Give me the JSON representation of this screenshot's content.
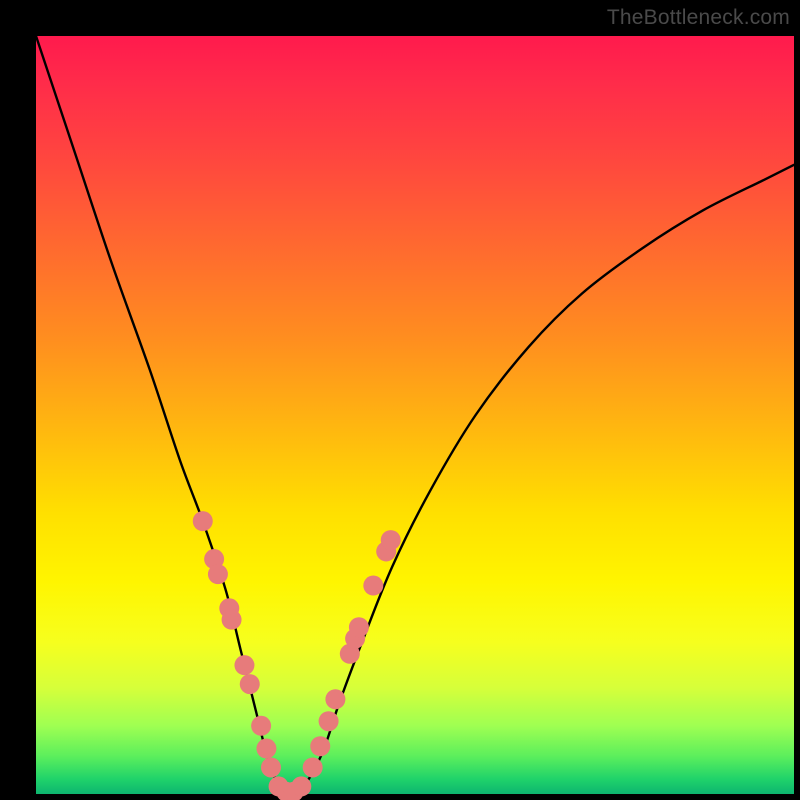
{
  "watermark": "TheBottleneck.com",
  "colors": {
    "frame": "#000000",
    "marker": "#e77b7b",
    "curve": "#000000",
    "gradient_top": "#ff1a4d",
    "gradient_bottom": "#0db56f"
  },
  "chart_data": {
    "type": "line",
    "title": "",
    "xlabel": "",
    "ylabel": "",
    "xlim": [
      0,
      100
    ],
    "ylim": [
      0,
      100
    ],
    "note": "Axes are unlabeled; x and y expressed as 0–100 percent of plot area. y=0 is bottom, y=100 is top.",
    "series": [
      {
        "name": "bottleneck-curve",
        "x": [
          0,
          5,
          10,
          15,
          19,
          22,
          25,
          27,
          29,
          30.5,
          32,
          33,
          34,
          36,
          38,
          40,
          43,
          47,
          52,
          58,
          65,
          72,
          80,
          88,
          96,
          100
        ],
        "y": [
          100,
          85,
          70,
          56,
          44,
          36,
          27,
          19,
          11,
          5,
          1,
          0,
          0,
          2,
          6,
          12,
          20,
          30,
          40,
          50,
          59,
          66,
          72,
          77,
          81,
          83
        ]
      }
    ],
    "markers": {
      "name": "highlighted-points",
      "note": "Salmon dots clustered on the lower V of the curve, both arms.",
      "points": [
        {
          "x": 22.0,
          "y": 36.0
        },
        {
          "x": 23.5,
          "y": 31.0
        },
        {
          "x": 24.0,
          "y": 29.0
        },
        {
          "x": 25.5,
          "y": 24.5
        },
        {
          "x": 25.8,
          "y": 23.0
        },
        {
          "x": 27.5,
          "y": 17.0
        },
        {
          "x": 28.2,
          "y": 14.5
        },
        {
          "x": 29.7,
          "y": 9.0
        },
        {
          "x": 30.4,
          "y": 6.0
        },
        {
          "x": 31.0,
          "y": 3.5
        },
        {
          "x": 32.0,
          "y": 1.0
        },
        {
          "x": 33.0,
          "y": 0.3
        },
        {
          "x": 34.0,
          "y": 0.3
        },
        {
          "x": 35.0,
          "y": 1.0
        },
        {
          "x": 36.5,
          "y": 3.5
        },
        {
          "x": 37.5,
          "y": 6.3
        },
        {
          "x": 38.6,
          "y": 9.6
        },
        {
          "x": 39.5,
          "y": 12.5
        },
        {
          "x": 41.4,
          "y": 18.5
        },
        {
          "x": 42.1,
          "y": 20.5
        },
        {
          "x": 42.6,
          "y": 22.0
        },
        {
          "x": 44.5,
          "y": 27.5
        },
        {
          "x": 46.2,
          "y": 32.0
        },
        {
          "x": 46.8,
          "y": 33.5
        }
      ]
    }
  }
}
